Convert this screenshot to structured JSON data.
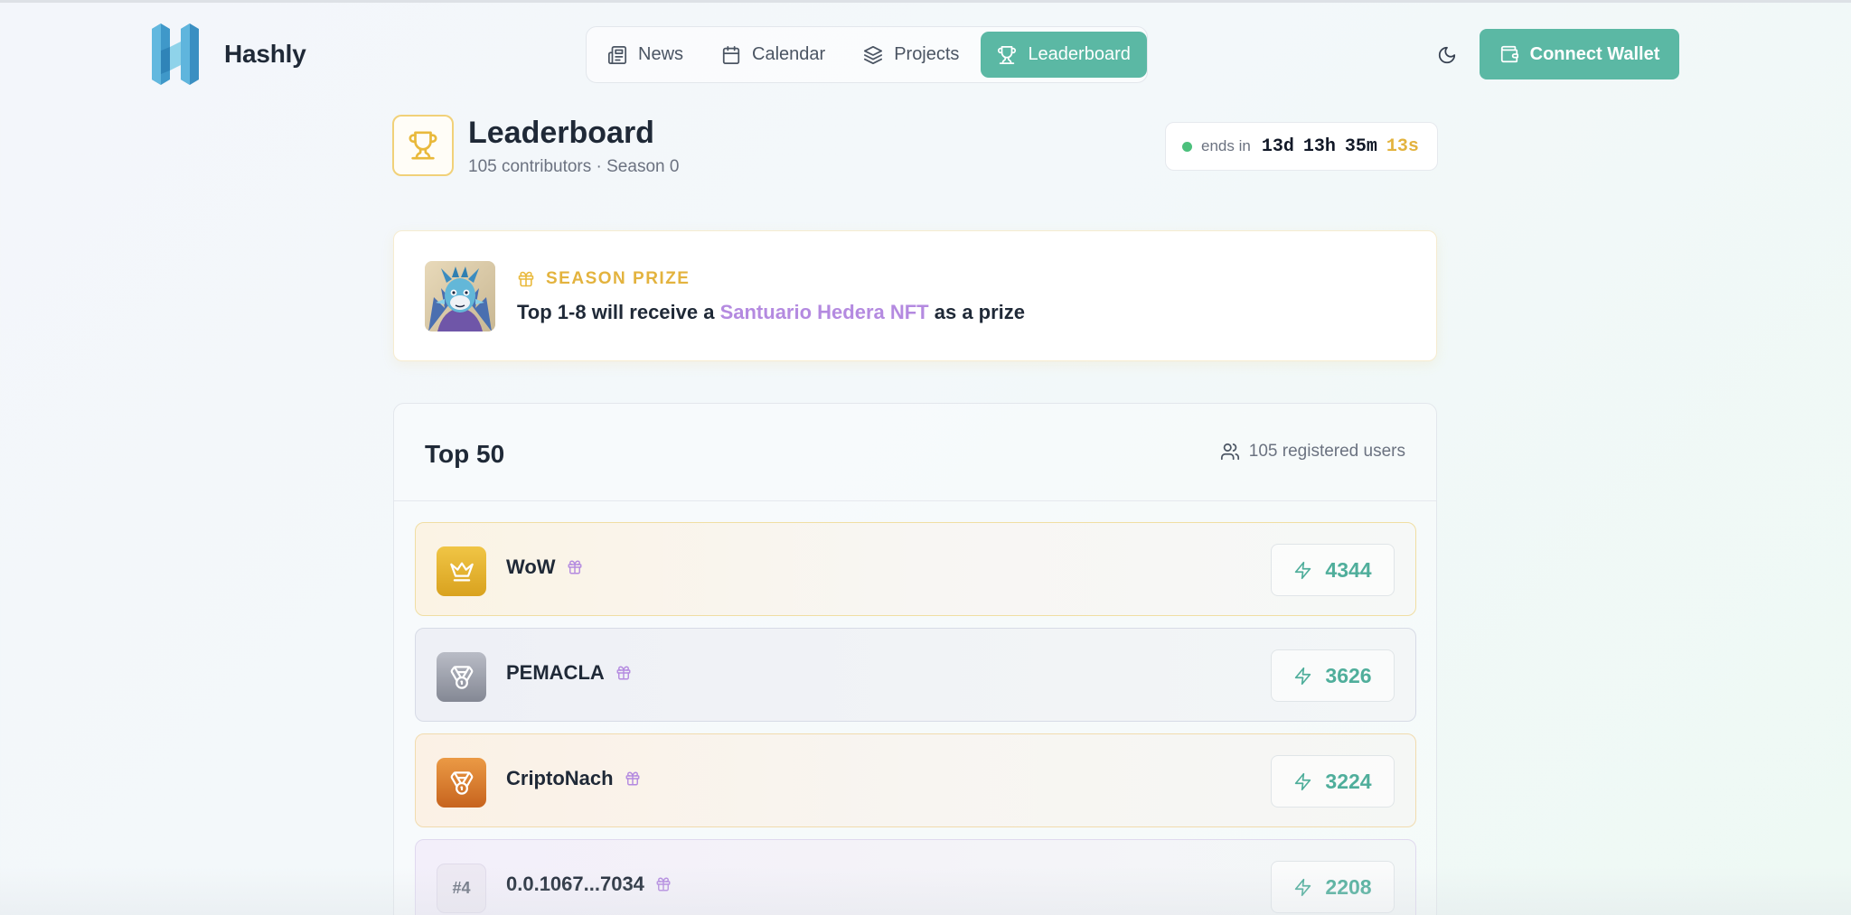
{
  "app": {
    "brand": "Hashly"
  },
  "nav": {
    "items": [
      {
        "label": "News",
        "icon": "newspaper-icon",
        "active": false
      },
      {
        "label": "Calendar",
        "icon": "calendar-icon",
        "active": false
      },
      {
        "label": "Projects",
        "icon": "layers-icon",
        "active": false
      },
      {
        "label": "Leaderboard",
        "icon": "trophy-icon",
        "active": true
      }
    ]
  },
  "header": {
    "connect_label": "Connect Wallet"
  },
  "page": {
    "title": "Leaderboard",
    "subtitle": "105 contributors · Season 0",
    "timer": {
      "ends_label": "ends in",
      "days": "13d",
      "hours": "13h",
      "minutes": "35m",
      "seconds": "13s"
    }
  },
  "prize": {
    "label": "SEASON PRIZE",
    "text_before": "Top 1-8 will receive a ",
    "nft_name": "Santuario Hedera NFT",
    "text_after": " as a prize"
  },
  "board": {
    "title": "Top 50",
    "users": "105 registered users",
    "rows": [
      {
        "rank": "#1",
        "name": "WoW",
        "score": "4344",
        "tier": "gold"
      },
      {
        "rank": "#2",
        "name": "PEMACLA",
        "score": "3626",
        "tier": "silver"
      },
      {
        "rank": "#3",
        "name": "CriptoNach",
        "score": "3224",
        "tier": "bronze"
      },
      {
        "rank": "#4",
        "name": "0.0.1067...7034",
        "score": "2208",
        "tier": "plain"
      }
    ]
  },
  "colors": {
    "accent": "#5bb8a4",
    "gold": "#e3b33e",
    "nft": "#b48ae0"
  }
}
